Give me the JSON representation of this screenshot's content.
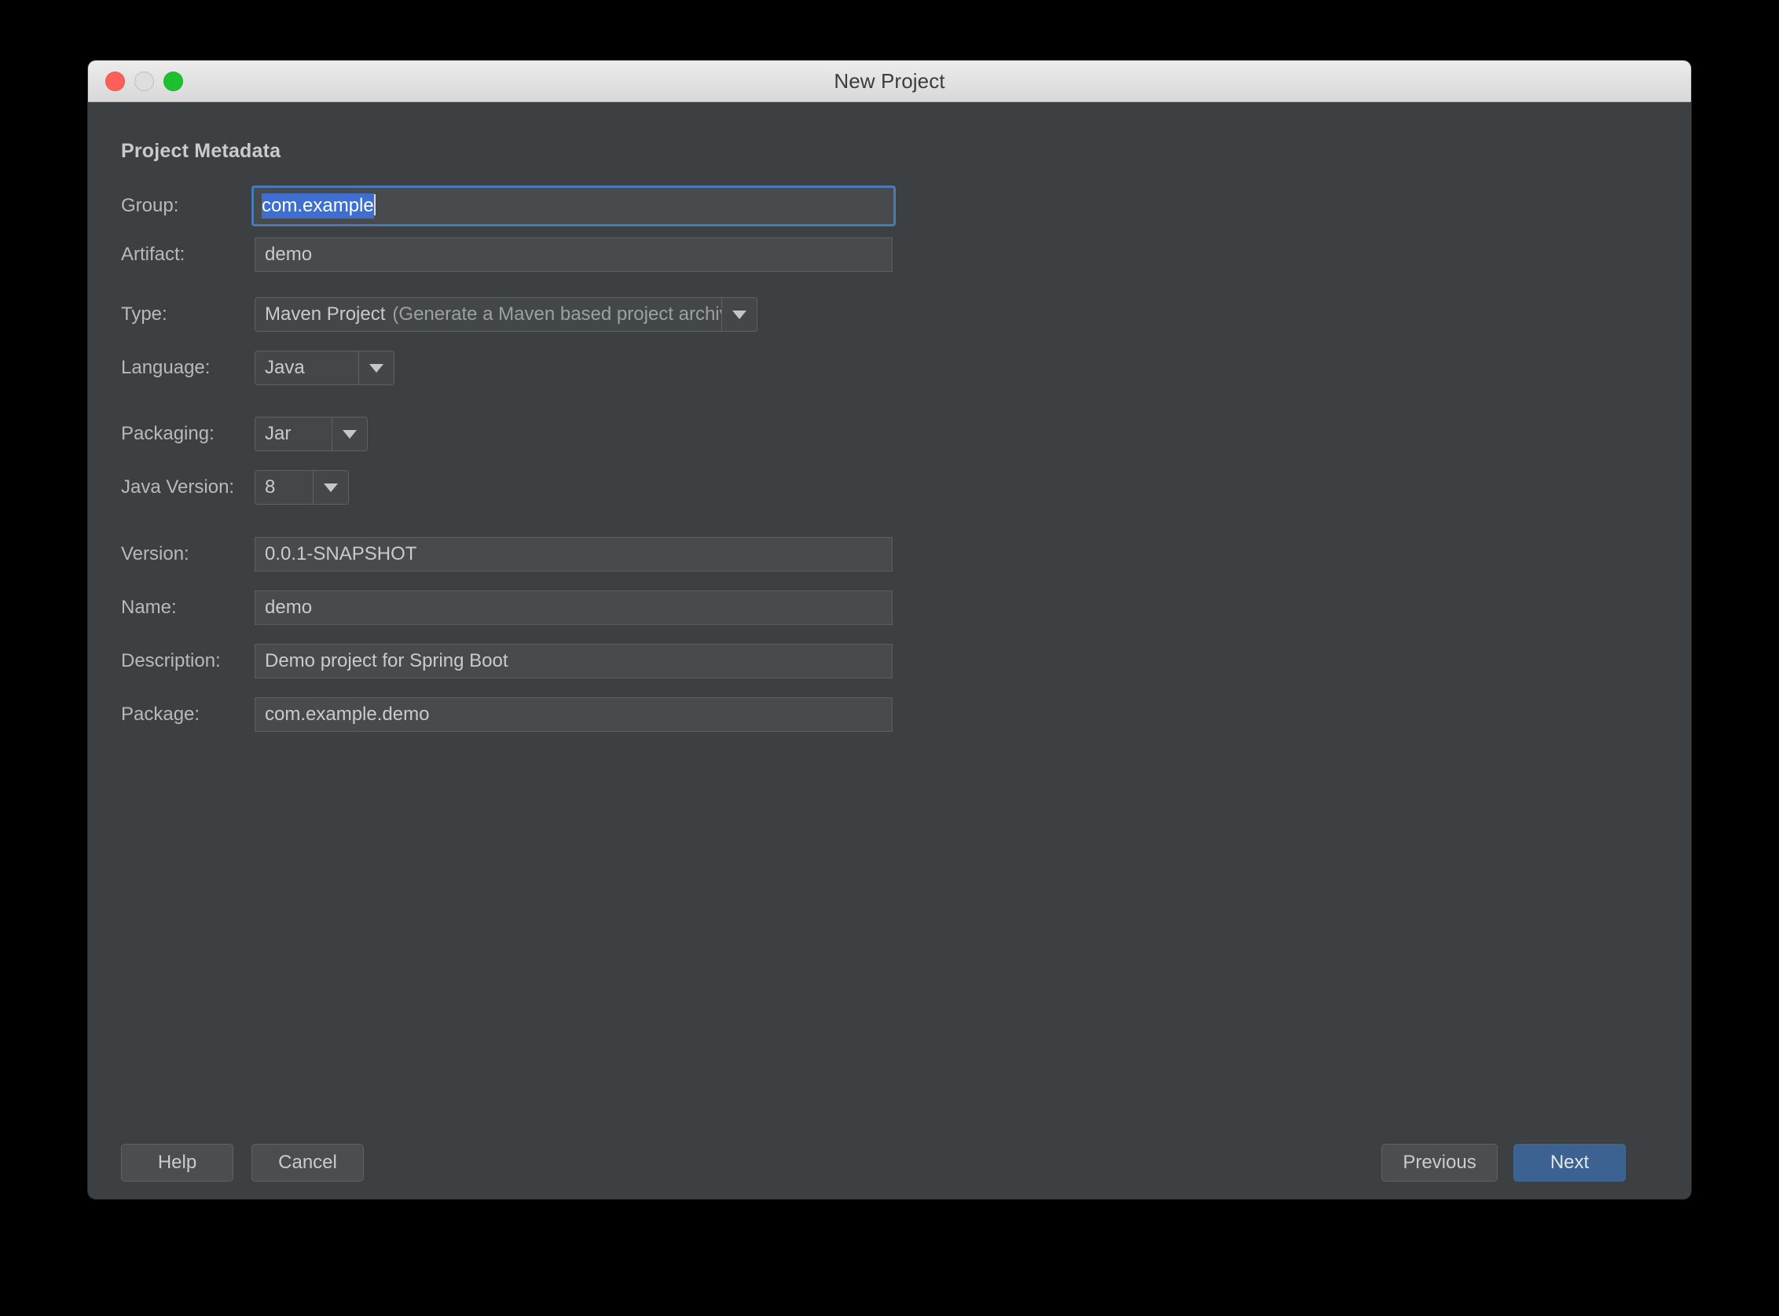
{
  "window": {
    "title": "New Project",
    "traffic_lights": [
      {
        "name": "close",
        "color": "#FF5F57"
      },
      {
        "name": "minimize",
        "color": "#DEDEDE"
      },
      {
        "name": "maximize",
        "color": "#1FC02F"
      }
    ]
  },
  "section": {
    "title": "Project Metadata"
  },
  "fields": {
    "group": {
      "label": "Group:",
      "value": "com.example",
      "selected": true,
      "focused": true
    },
    "artifact": {
      "label": "Artifact:",
      "value": "demo"
    },
    "type": {
      "label": "Type:",
      "value": "Maven Project",
      "value_detail": "(Generate a Maven based project archive)",
      "arrow_icon": "chevron-down-icon"
    },
    "language": {
      "label": "Language:",
      "value": "Java",
      "arrow_icon": "chevron-down-icon"
    },
    "packaging": {
      "label": "Packaging:",
      "value": "Jar",
      "arrow_icon": "chevron-down-icon"
    },
    "java_version": {
      "label": "Java Version:",
      "value": "8",
      "arrow_icon": "chevron-down-icon"
    },
    "version": {
      "label": "Version:",
      "value": "0.0.1-SNAPSHOT"
    },
    "name": {
      "label": "Name:",
      "value": "demo"
    },
    "description": {
      "label": "Description:",
      "value": "Demo project for Spring Boot"
    },
    "package": {
      "label": "Package:",
      "value": "com.example.demo"
    }
  },
  "footer": {
    "help": "Help",
    "cancel": "Cancel",
    "previous": "Previous",
    "next": "Next"
  },
  "colors": {
    "dialog_background": "#3C4043",
    "field_background": "#474B4E",
    "selection_blue": "#3C6FD0",
    "focus_border": "#4A7AB5",
    "primary_button": "#3C6291",
    "text": "#C8CBCD",
    "text_dim": "#9BA0A3"
  }
}
